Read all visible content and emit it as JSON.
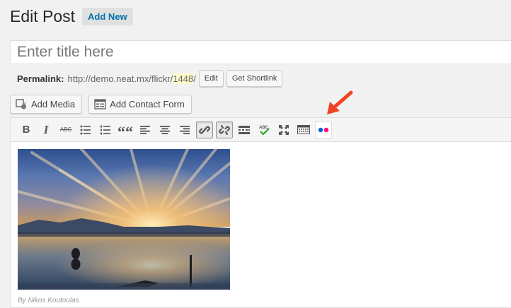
{
  "header": {
    "title": "Edit Post",
    "add_new": "Add New"
  },
  "title_field": {
    "placeholder": "Enter title here",
    "value": ""
  },
  "permalink": {
    "label": "Permalink:",
    "base": "http://demo.neat.mx/flickr/",
    "slug": "1448",
    "trailing": "/",
    "edit_label": "Edit",
    "shortlink_label": "Get Shortlink"
  },
  "media_buttons": {
    "add_media": "Add Media",
    "add_contact_form": "Add Contact Form"
  },
  "toolbar": {
    "bold": "B",
    "italic": "I",
    "strikethrough": "ABC",
    "blockquote": "““",
    "flickr_button_colors": [
      "#0063dc",
      "#ff0084"
    ]
  },
  "content": {
    "caption": "By Nikos Koutoulas"
  },
  "colors": {
    "accent": "#0073aa",
    "arrow": "#ee4423"
  }
}
